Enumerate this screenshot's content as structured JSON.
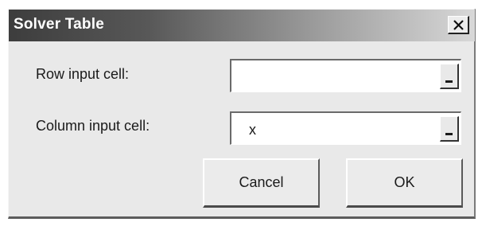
{
  "window": {
    "title": "Solver Table",
    "close_icon": "close-icon"
  },
  "form": {
    "row_input": {
      "label": "Row input cell:",
      "value": ""
    },
    "column_input": {
      "label": "Column input cell:",
      "value": "x"
    },
    "ref_button_icon": "collapse-dialog-icon"
  },
  "buttons": {
    "cancel_label": "Cancel",
    "ok_label": "OK"
  },
  "colors": {
    "dialog_bg": "#e9e9e9",
    "titlebar_dark": "#3d3d3d",
    "titlebar_light": "#d8d8d8",
    "field_bg": "#ffffff"
  }
}
